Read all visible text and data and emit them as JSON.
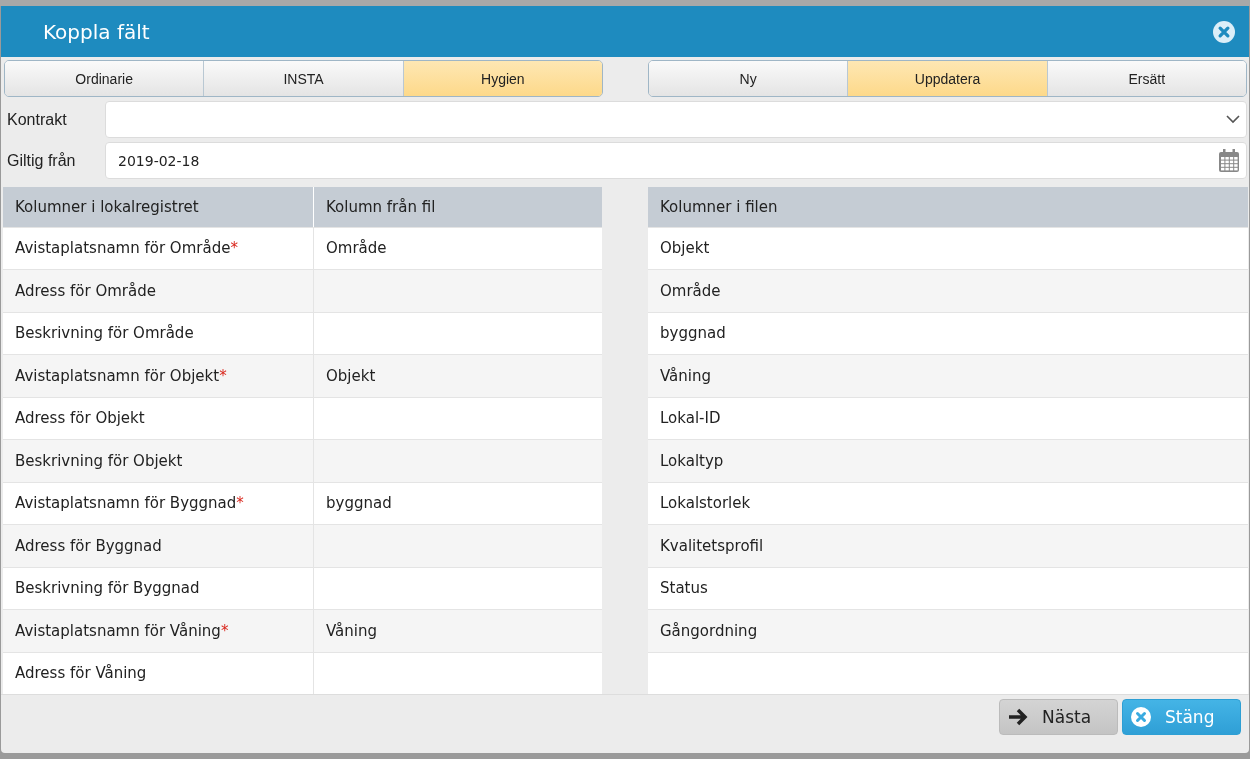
{
  "dialog": {
    "title": "Koppla fält"
  },
  "type_tabs": [
    {
      "label": "Ordinarie",
      "selected": false
    },
    {
      "label": "INSTA",
      "selected": false
    },
    {
      "label": "Hygien",
      "selected": true
    }
  ],
  "mode_tabs": [
    {
      "label": "Ny",
      "selected": false
    },
    {
      "label": "Uppdatera",
      "selected": true
    },
    {
      "label": "Ersätt",
      "selected": false
    }
  ],
  "form": {
    "contract_label": "Kontrakt",
    "valid_from_label": "Giltig från",
    "valid_from_value": "2019-02-18"
  },
  "mapping_table": {
    "columns": [
      "Kolumner i lokalregistret",
      "Kolumn från fil"
    ],
    "rows": [
      {
        "field": "Avistaplatsnamn för Område",
        "required_mark": "*",
        "source": "Område"
      },
      {
        "field": "Adress för Område"
      },
      {
        "field": "Beskrivning för Område"
      },
      {
        "field": "Avistaplatsnamn för Objekt",
        "required_mark": "*",
        "source": "Objekt"
      },
      {
        "field": "Adress för Objekt"
      },
      {
        "field": "Beskrivning för Objekt"
      },
      {
        "field": "Avistaplatsnamn för Byggnad",
        "required_mark": "*",
        "source": "byggnad"
      },
      {
        "field": "Adress för Byggnad"
      },
      {
        "field": "Beskrivning för Byggnad"
      },
      {
        "field": "Avistaplatsnamn för Våning",
        "required_mark": "*",
        "source": "Våning"
      },
      {
        "field": "Adress för Våning"
      }
    ]
  },
  "file_table": {
    "column": "Kolumner i filen",
    "rows": [
      "Objekt",
      "Område",
      "byggnad",
      "Våning",
      "Lokal-ID",
      "Lokaltyp",
      "Lokalstorlek",
      "Kvalitetsprofil",
      "Status",
      "Gångordning"
    ]
  },
  "buttons": [
    {
      "kind": "next",
      "label": "Nästa"
    },
    {
      "kind": "close",
      "label": "Stäng"
    }
  ]
}
